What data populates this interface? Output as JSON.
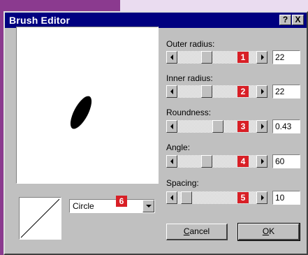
{
  "window": {
    "title": "Brush Editor",
    "help_label": "?",
    "close_label": "X"
  },
  "fields": [
    {
      "label": "Outer radius:",
      "badge": "1",
      "value": "22",
      "slider_fraction": 0.35
    },
    {
      "label": "Inner radius:",
      "badge": "2",
      "value": "22",
      "slider_fraction": 0.35
    },
    {
      "label": "Roundness:",
      "badge": "3",
      "value": "0.43",
      "slider_fraction": 0.52
    },
    {
      "label": "Angle:",
      "badge": "4",
      "value": "60",
      "slider_fraction": 0.35
    },
    {
      "label": "Spacing:",
      "badge": "5",
      "value": "10",
      "slider_fraction": 0.05
    }
  ],
  "shape": {
    "selected": "Circle",
    "badge": "6"
  },
  "buttons": {
    "cancel_mnemonic": "C",
    "cancel_rest": "ancel",
    "ok_mnemonic": "O",
    "ok_rest": "K"
  },
  "colors": {
    "titlebar": "#000080",
    "dialog": "#c0c0c0",
    "badge": "#d81f26"
  }
}
